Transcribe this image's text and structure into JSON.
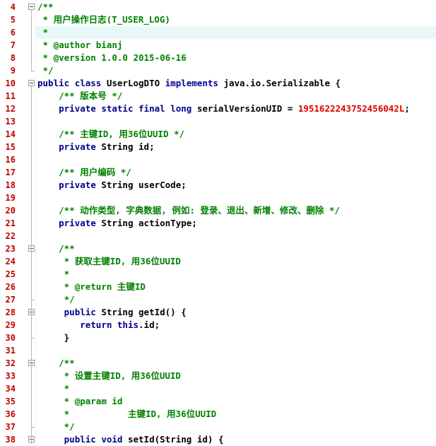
{
  "editor": {
    "language": "java",
    "colors": {
      "keyword": "#00008b",
      "comment": "#008000",
      "number": "#e00000",
      "line_number": "#c00000",
      "current_line_bg": "#e8f8f8"
    },
    "first_line_number": 4,
    "current_line": 6,
    "lines": [
      {
        "n": "4",
        "tokens": [
          [
            "cm",
            "/**"
          ]
        ],
        "fold": "open"
      },
      {
        "n": "5",
        "tokens": [
          [
            "cm",
            " * 用户操作日志(T_USER_LOG)"
          ]
        ]
      },
      {
        "n": "6",
        "tokens": [
          [
            "cm",
            " *"
          ]
        ]
      },
      {
        "n": "7",
        "tokens": [
          [
            "cm",
            " * @author bianj"
          ]
        ]
      },
      {
        "n": "8",
        "tokens": [
          [
            "cm",
            " * @version 1.0.0 2015-06-16"
          ]
        ]
      },
      {
        "n": "9",
        "tokens": [
          [
            "cm",
            " */"
          ]
        ],
        "fold": "end"
      },
      {
        "n": "10",
        "tokens": [
          [
            "kw",
            "public"
          ],
          [
            "sym",
            " "
          ],
          [
            "kw",
            "class"
          ],
          [
            "sym",
            " "
          ],
          [
            "id",
            "UserLogDTO"
          ],
          [
            "sym",
            " "
          ],
          [
            "kw",
            "implements"
          ],
          [
            "sym",
            " "
          ],
          [
            "id",
            "java.io.Serializable"
          ],
          [
            "sym",
            " {"
          ]
        ],
        "fold": "open"
      },
      {
        "n": "11",
        "tokens": [
          [
            "sym",
            "    "
          ],
          [
            "cm",
            "/** 版本号 */"
          ]
        ]
      },
      {
        "n": "12",
        "tokens": [
          [
            "sym",
            "    "
          ],
          [
            "kw",
            "private"
          ],
          [
            "sym",
            " "
          ],
          [
            "kw",
            "static"
          ],
          [
            "sym",
            " "
          ],
          [
            "kw",
            "final"
          ],
          [
            "sym",
            " "
          ],
          [
            "kw",
            "long"
          ],
          [
            "sym",
            " "
          ],
          [
            "id",
            "serialVersionUID"
          ],
          [
            "sym",
            " = "
          ],
          [
            "num",
            "1951622243752456042L"
          ],
          [
            "sym",
            ";"
          ]
        ]
      },
      {
        "n": "13",
        "tokens": []
      },
      {
        "n": "14",
        "tokens": [
          [
            "sym",
            "    "
          ],
          [
            "cm",
            "/** 主键ID, 用36位UUID */"
          ]
        ]
      },
      {
        "n": "15",
        "tokens": [
          [
            "sym",
            "    "
          ],
          [
            "kw",
            "private"
          ],
          [
            "sym",
            " "
          ],
          [
            "id",
            "String"
          ],
          [
            "sym",
            " "
          ],
          [
            "id",
            "id"
          ],
          [
            "sym",
            ";"
          ]
        ]
      },
      {
        "n": "16",
        "tokens": []
      },
      {
        "n": "17",
        "tokens": [
          [
            "sym",
            "    "
          ],
          [
            "cm",
            "/** 用户编码 */"
          ]
        ]
      },
      {
        "n": "18",
        "tokens": [
          [
            "sym",
            "    "
          ],
          [
            "kw",
            "private"
          ],
          [
            "sym",
            " "
          ],
          [
            "id",
            "String"
          ],
          [
            "sym",
            " "
          ],
          [
            "id",
            "userCode"
          ],
          [
            "sym",
            ";"
          ]
        ]
      },
      {
        "n": "19",
        "tokens": []
      },
      {
        "n": "20",
        "tokens": [
          [
            "sym",
            "    "
          ],
          [
            "cm",
            "/** 动作类型, 字典数据, 例如: 登录、退出、新增、修改、删除 */"
          ]
        ]
      },
      {
        "n": "21",
        "tokens": [
          [
            "sym",
            "    "
          ],
          [
            "kw",
            "private"
          ],
          [
            "sym",
            " "
          ],
          [
            "id",
            "String"
          ],
          [
            "sym",
            " "
          ],
          [
            "id",
            "actionType"
          ],
          [
            "sym",
            ";"
          ]
        ]
      },
      {
        "n": "22",
        "tokens": []
      },
      {
        "n": "23",
        "tokens": [
          [
            "sym",
            "    "
          ],
          [
            "cm",
            "/**"
          ]
        ],
        "fold": "open"
      },
      {
        "n": "24",
        "tokens": [
          [
            "sym",
            "     "
          ],
          [
            "cm",
            "* 获取主键ID, 用36位UUID"
          ]
        ]
      },
      {
        "n": "25",
        "tokens": [
          [
            "sym",
            "     "
          ],
          [
            "cm",
            "*"
          ]
        ]
      },
      {
        "n": "26",
        "tokens": [
          [
            "sym",
            "     "
          ],
          [
            "cm",
            "* @return 主键ID"
          ]
        ]
      },
      {
        "n": "27",
        "tokens": [
          [
            "sym",
            "     "
          ],
          [
            "cm",
            "*/"
          ]
        ],
        "fold": "end"
      },
      {
        "n": "28",
        "tokens": [
          [
            "sym",
            "     "
          ],
          [
            "kw",
            "public"
          ],
          [
            "sym",
            " "
          ],
          [
            "id",
            "String"
          ],
          [
            "sym",
            " "
          ],
          [
            "id",
            "getId"
          ],
          [
            "sym",
            "() {"
          ]
        ],
        "fold": "open"
      },
      {
        "n": "29",
        "tokens": [
          [
            "sym",
            "        "
          ],
          [
            "kw",
            "return"
          ],
          [
            "sym",
            " "
          ],
          [
            "kw",
            "this"
          ],
          [
            "sym",
            "."
          ],
          [
            "id",
            "id"
          ],
          [
            "sym",
            ";"
          ]
        ]
      },
      {
        "n": "30",
        "tokens": [
          [
            "sym",
            "     }"
          ]
        ],
        "fold": "end"
      },
      {
        "n": "31",
        "tokens": []
      },
      {
        "n": "32",
        "tokens": [
          [
            "sym",
            "    "
          ],
          [
            "cm",
            "/**"
          ]
        ],
        "fold": "open"
      },
      {
        "n": "33",
        "tokens": [
          [
            "sym",
            "     "
          ],
          [
            "cm",
            "* 设置主键ID, 用36位UUID"
          ]
        ]
      },
      {
        "n": "34",
        "tokens": [
          [
            "sym",
            "     "
          ],
          [
            "cm",
            "*"
          ]
        ]
      },
      {
        "n": "35",
        "tokens": [
          [
            "sym",
            "     "
          ],
          [
            "cm",
            "* @param id"
          ]
        ]
      },
      {
        "n": "36",
        "tokens": [
          [
            "sym",
            "     "
          ],
          [
            "cm",
            "*           主键ID, 用36位UUID"
          ]
        ]
      },
      {
        "n": "37",
        "tokens": [
          [
            "sym",
            "     "
          ],
          [
            "cm",
            "*/"
          ]
        ],
        "fold": "end"
      },
      {
        "n": "38",
        "tokens": [
          [
            "sym",
            "     "
          ],
          [
            "kw",
            "public"
          ],
          [
            "sym",
            " "
          ],
          [
            "kw",
            "void"
          ],
          [
            "sym",
            " "
          ],
          [
            "id",
            "setId"
          ],
          [
            "sym",
            "("
          ],
          [
            "id",
            "String"
          ],
          [
            "sym",
            " "
          ],
          [
            "id",
            "id"
          ],
          [
            "sym",
            ") {"
          ]
        ],
        "fold": "open"
      }
    ]
  }
}
